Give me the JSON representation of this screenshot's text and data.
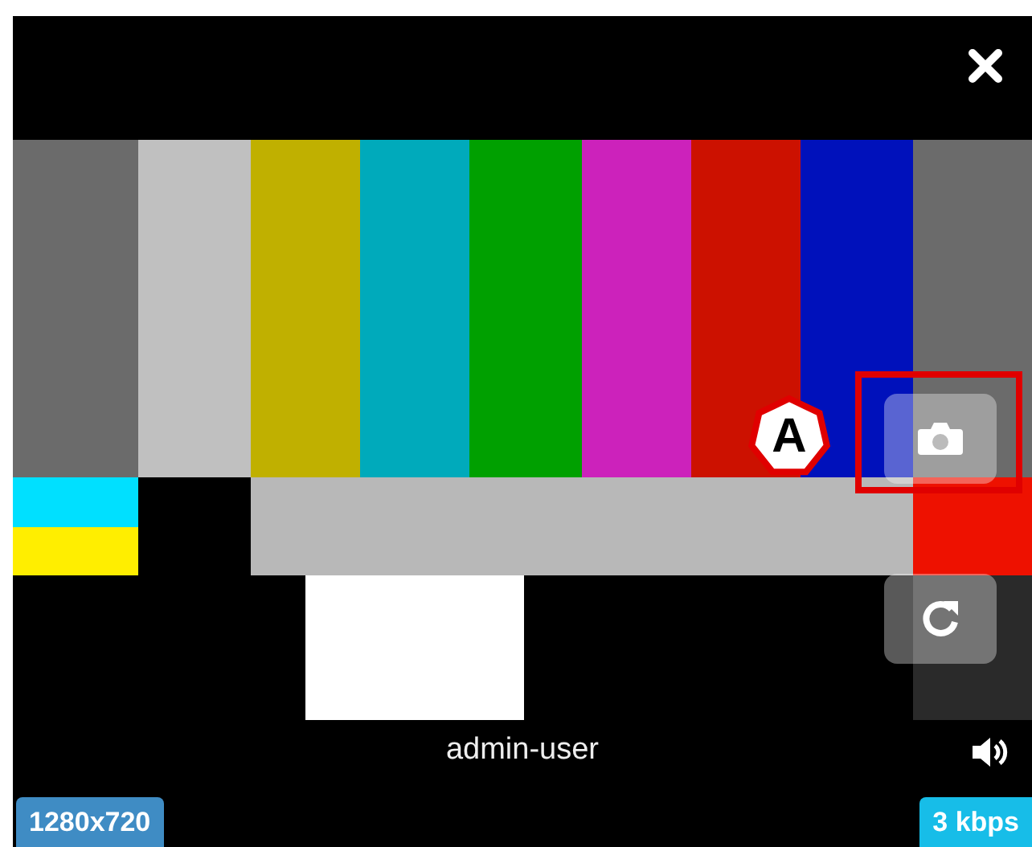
{
  "stream": {
    "username": "admin-user",
    "resolution": "1280x720",
    "bitrate": "3 kbps"
  },
  "callouts": [
    {
      "label": "A"
    }
  ]
}
